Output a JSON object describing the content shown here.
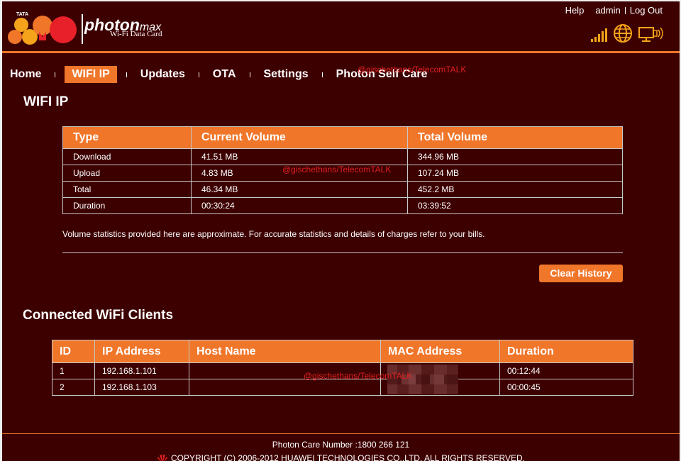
{
  "header": {
    "logo_text": "TATA",
    "brand_name": "photon",
    "brand_suffix": "max",
    "brand_sub": "Wi-Fi Data Card",
    "links": {
      "help": "Help",
      "user": "admin",
      "logout": "Log Out"
    },
    "signal_bars": 5,
    "icons": [
      "signal-bars-icon",
      "globe-icon",
      "device-connection-icon"
    ]
  },
  "nav": {
    "items": [
      {
        "label": "Home"
      },
      {
        "label": "WIFI IP",
        "active": true
      },
      {
        "label": "Updates"
      },
      {
        "label": "OTA"
      },
      {
        "label": "Settings"
      },
      {
        "label": "Photon Self Care"
      }
    ]
  },
  "watermark": "@gischethans/TelecomTALK",
  "page_title": "WIFI IP",
  "volume_table": {
    "headers": [
      "Type",
      "Current Volume",
      "Total Volume"
    ],
    "rows": [
      [
        "Download",
        "41.51 MB",
        "344.96 MB"
      ],
      [
        "Upload",
        "4.83 MB",
        "107.24 MB"
      ],
      [
        "Total",
        "46.34 MB",
        "452.2 MB"
      ],
      [
        "Duration",
        "00:30:24",
        "03:39:52"
      ]
    ]
  },
  "note": "Volume statistics provided here are approximate. For accurate statistics and details of charges refer to your bills.",
  "clear_history_label": "Clear History",
  "clients_title": "Connected WiFi Clients",
  "clients_table": {
    "headers": [
      "ID",
      "IP Address",
      "Host Name",
      "MAC Address",
      "Duration"
    ],
    "rows": [
      [
        "1",
        "192.168.1.101",
        "",
        "",
        "00:12:44"
      ],
      [
        "2",
        "192.168.1.103",
        "",
        "",
        "00:00:45"
      ]
    ]
  },
  "footer": {
    "care": "Photon Care Number :1800 266 121",
    "copyright": "COPYRIGHT (C) 2006-2012 HUAWEI TECHNOLOGIES CO.,LTD. ALL RIGHTS RESERVED."
  },
  "colors": {
    "background": "#3d0000",
    "accent": "#f0762a",
    "border": "#c7c7c7",
    "watermark": "#e02020"
  }
}
